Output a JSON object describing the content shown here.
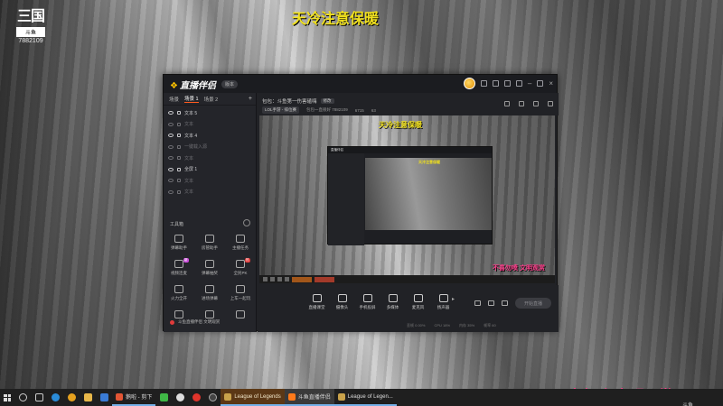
{
  "overlay": {
    "top_banner": "天冷注意保暖",
    "bottom_banner": "不喜勿喷 文明观赏",
    "logo_big": "三国",
    "logo_tag": "斗鱼",
    "logo_num": "7882109",
    "corner_mark": "斗鱼"
  },
  "app": {
    "name": "直播伴侣",
    "version": "版本",
    "scene_tabs": [
      "场景",
      "场景 1",
      "场景 2"
    ],
    "add_label": "+",
    "sources": [
      {
        "label": "文本 5",
        "dim": false
      },
      {
        "label": "文本",
        "dim": true
      },
      {
        "label": "文本 4",
        "dim": false
      },
      {
        "label": "一键载入源",
        "dim": true
      },
      {
        "label": "文本",
        "dim": true
      },
      {
        "label": "全屏 1",
        "dim": false
      },
      {
        "label": "文本",
        "dim": true
      },
      {
        "label": "文本",
        "dim": true
      }
    ],
    "tools_title": "工具箱",
    "tools": [
      {
        "label": "弹幕助手",
        "icon": "danmu-icon",
        "hot": ""
      },
      {
        "label": "房管助手",
        "icon": "admin-icon",
        "hot": ""
      },
      {
        "label": "主播任务",
        "icon": "task-icon",
        "hot": ""
      },
      {
        "label": "视频连麦",
        "icon": "video-link-icon",
        "hot": "新"
      },
      {
        "label": "弹幕抽奖",
        "icon": "lottery-icon",
        "hot": ""
      },
      {
        "label": "全民PK",
        "icon": "pk-icon",
        "hot": "热"
      },
      {
        "label": "火力全开",
        "icon": "fire-icon",
        "hot": ""
      },
      {
        "label": "进场弹幕",
        "icon": "enter-icon",
        "hot": ""
      },
      {
        "label": "上车一起玩",
        "icon": "car-icon",
        "hot": ""
      },
      {
        "label": "",
        "icon": "more-icon",
        "hot": ""
      },
      {
        "label": "",
        "icon": "more-icon",
        "hot": ""
      },
      {
        "label": "",
        "icon": "more-icon",
        "hot": ""
      }
    ],
    "danmu_foot": "斗鱼直播伴侣 文明观赏",
    "room": {
      "title": "包包：斗鱼第一伤害磕嗨",
      "edit": "修改",
      "category": "LOL手游 - 排位赛",
      "room_id": "包包一直很好 7882109",
      "fans": "6715",
      "viewers": "63"
    },
    "preview": {
      "banner": "天冷注意保暖",
      "pink": "不喜勿喷 文明观赏",
      "nested_title": "直播伴侣",
      "nested_banner": "天冷注意保暖"
    },
    "controls": [
      {
        "label": "直播课堂",
        "icon": "screen-icon"
      },
      {
        "label": "摄像头",
        "icon": "camera-icon"
      },
      {
        "label": "手机投屏",
        "icon": "phone-cast-icon"
      },
      {
        "label": "多媒体",
        "icon": "media-icon"
      },
      {
        "label": "麦克风",
        "icon": "mic-icon"
      },
      {
        "label": "扬声器",
        "icon": "speaker-icon"
      }
    ],
    "go_live": "开始直播",
    "stats": [
      "丢帧 0.00%",
      "CPU 18%",
      "内存 35%",
      "帧率 60"
    ]
  },
  "taskbar": {
    "apps": [
      "search",
      "task-view",
      "edge",
      "chrome",
      "files",
      "mail",
      "wechat"
    ],
    "pinned_label": "鹅啦 - 剪下",
    "lol_label": "League of Legends",
    "douyu_label": "斗鱼直播伴侣",
    "lol2_label": "League of Legen..."
  }
}
